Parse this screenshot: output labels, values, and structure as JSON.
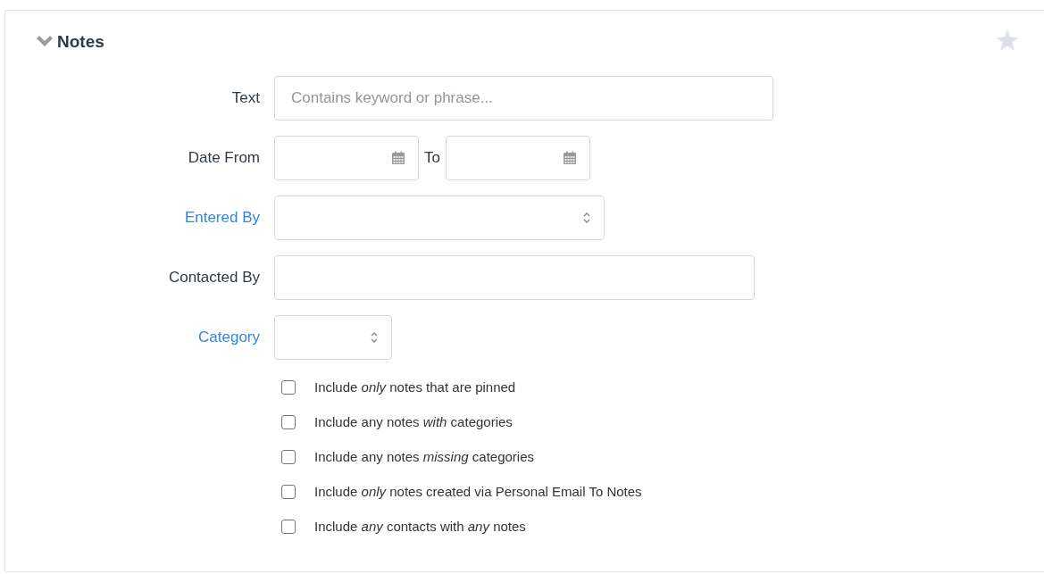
{
  "panel": {
    "title": "Notes",
    "expanded": true,
    "starred": false
  },
  "fields": [
    {
      "kind": "text",
      "label": "Text",
      "link": false,
      "placeholder": "Contains keyword or phrase..."
    },
    {
      "kind": "daterange",
      "label": "Date From",
      "link": false,
      "separator": "To"
    },
    {
      "kind": "select",
      "label": "Entered By",
      "link": true
    },
    {
      "kind": "text",
      "label": "Contacted By",
      "link": false
    },
    {
      "kind": "select",
      "label": "Category",
      "link": true
    }
  ],
  "options": [
    {
      "label": "Include *only* notes that are pinned",
      "checked": false
    },
    {
      "label": "Include any notes *with* categories",
      "checked": false
    },
    {
      "label": "Include any notes *missing* categories",
      "checked": false
    },
    {
      "label": "Include *only* notes created via Personal Email To Notes",
      "checked": false
    },
    {
      "label": "Include *any* contacts with *any* notes",
      "checked": false
    }
  ]
}
